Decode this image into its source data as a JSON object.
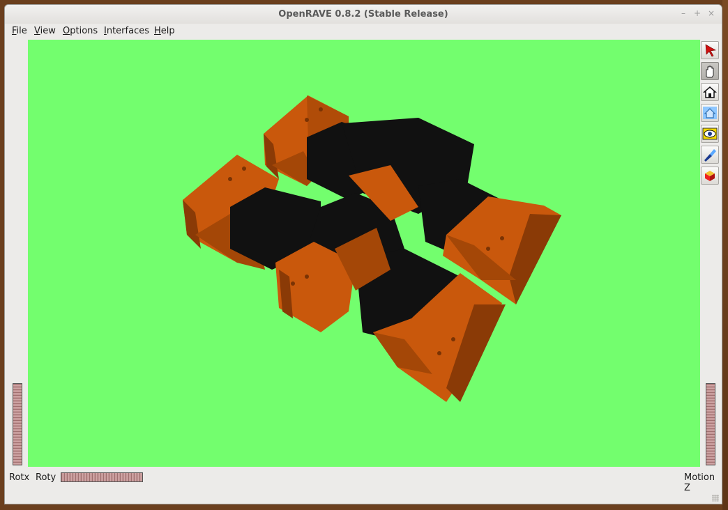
{
  "window": {
    "title": "OpenRAVE 0.8.2 (Stable Release)",
    "controls": [
      "minimize-icon",
      "maximize-icon",
      "close-icon"
    ]
  },
  "menubar": {
    "items": [
      {
        "label": "File",
        "mnemonic": "F",
        "rest": "ile"
      },
      {
        "label": "View",
        "mnemonic": "V",
        "rest": "iew"
      },
      {
        "label": "Options",
        "mnemonic": "O",
        "rest": "ptions"
      },
      {
        "label": "Interfaces",
        "mnemonic": "I",
        "rest": "nterfaces"
      },
      {
        "label": "Help",
        "mnemonic": "H",
        "rest": "elp"
      }
    ]
  },
  "viewport": {
    "background_color": "#73fe6e",
    "scene_description_colors": {
      "bracket": "#c9580c",
      "servo": "#111111"
    }
  },
  "toolbar": {
    "tools": [
      {
        "icon": "select-arrow-icon",
        "active": false
      },
      {
        "icon": "hand-pan-icon",
        "active": true
      },
      {
        "icon": "home-view-icon",
        "active": false
      },
      {
        "icon": "set-home-icon",
        "active": false
      },
      {
        "icon": "view-all-icon",
        "active": false
      },
      {
        "icon": "seek-icon",
        "active": false
      },
      {
        "icon": "projection-cube-icon",
        "active": false
      }
    ]
  },
  "thumbwheels": {
    "left_label": "Rotx",
    "bottom_label": "Roty",
    "right_label": "Motion Z"
  }
}
